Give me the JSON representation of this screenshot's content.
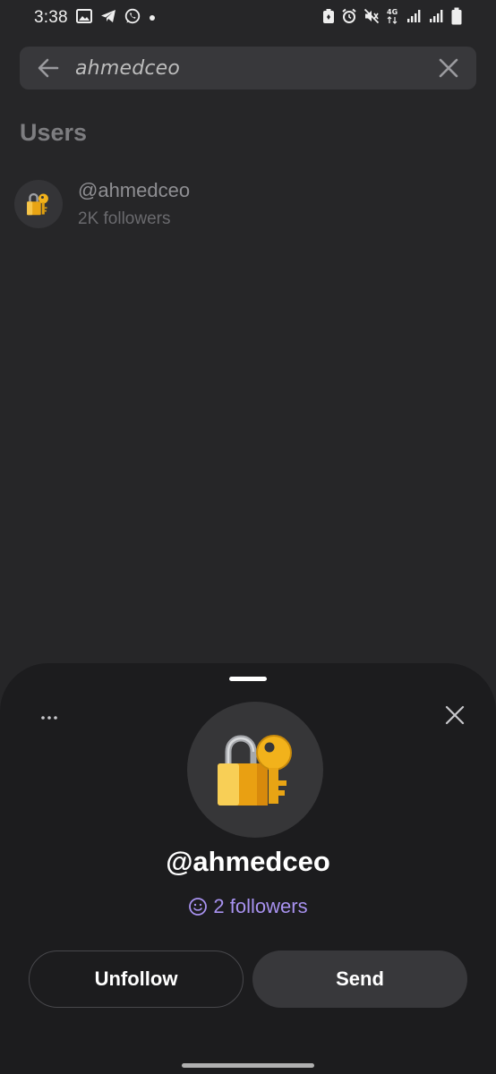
{
  "status_bar": {
    "time": "3:38",
    "left_icons": [
      "image-icon",
      "telegram-icon",
      "whatsapp-icon",
      "dot-icon"
    ],
    "right_icons": [
      "battery-saver-icon",
      "alarm-icon",
      "mute-icon",
      "network-4g-icon",
      "signal-icon",
      "signal-icon",
      "battery-icon"
    ],
    "network_label": "4G"
  },
  "search": {
    "value": "ahmedceo",
    "back_icon": "arrow-left-icon",
    "clear_icon": "close-icon"
  },
  "users_section": {
    "title": "Users",
    "items": [
      {
        "handle": "@ahmedceo",
        "followers": "2K followers",
        "avatar_icon": "lock-with-key-icon"
      }
    ]
  },
  "profile_sheet": {
    "more_icon": "more-horizontal-icon",
    "close_icon": "close-icon",
    "avatar_icon": "lock-with-key-icon",
    "handle": "@ahmedceo",
    "followers": "2 followers",
    "followers_icon": "smiley-icon",
    "unfollow_label": "Unfollow",
    "send_label": "Send"
  },
  "colors": {
    "background": "#262628",
    "sheet": "#1c1c1e",
    "accent": "#a892f0",
    "lock_gold": "#f2b21b"
  }
}
